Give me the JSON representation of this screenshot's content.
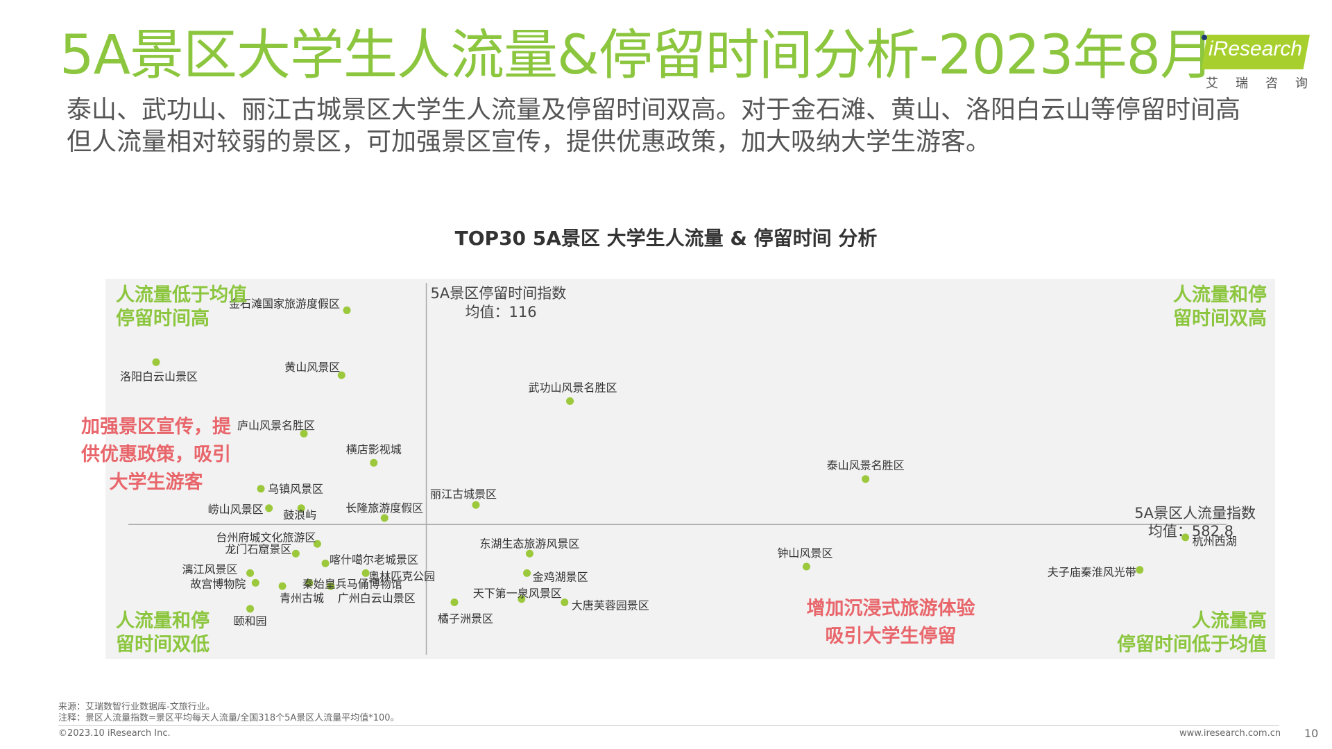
{
  "title": "5A景区大学生人流量&停留时间分析-2023年8月",
  "subtitle_line1": "泰山、武功山、丽江古城景区大学生人流量及停留时间双高。对于金石滩、黄山、洛阳白云山等停留时间高",
  "subtitle_line2": "但人流量相对较弱的景区，可加强景区宣传，提供优惠政策，加大吸纳大学生游客。",
  "logo": {
    "text": "Research",
    "cn": "艾瑞咨询"
  },
  "chart_title": "TOP30 5A景区 大学生人流量 & 停留时间 分析",
  "colors": {
    "accent": "#8cc63f",
    "point": "#9cc83b",
    "quadrant_label": "#8cc63f",
    "callout": "#e8666b",
    "plot_bg": "#f2f2f2"
  },
  "chart_data": {
    "type": "scatter",
    "xlabel": "5A景区人流量指数",
    "ylabel": "5A景区停留时间指数",
    "x_mean_label": "均值：582.8",
    "y_mean_label": "均值：116",
    "x_mean": 582.8,
    "y_mean": 116,
    "xlim": [
      0,
      2100
    ],
    "ylim": [
      75,
      190
    ],
    "points": [
      {
        "name": "金石滩国家旅游度假区",
        "x": 435,
        "y": 182
      },
      {
        "name": "洛阳白云山景区",
        "x": 80,
        "y": 166
      },
      {
        "name": "黄山风景区",
        "x": 425,
        "y": 162
      },
      {
        "name": "武功山风景名胜区",
        "x": 850,
        "y": 154
      },
      {
        "name": "庐山风景名胜区",
        "x": 355,
        "y": 144
      },
      {
        "name": "横店影视城",
        "x": 485,
        "y": 135
      },
      {
        "name": "泰山风景名胜区",
        "x": 1400,
        "y": 130
      },
      {
        "name": "乌镇风景区",
        "x": 275,
        "y": 127
      },
      {
        "name": "崂山风景区",
        "x": 290,
        "y": 121
      },
      {
        "name": "鼓浪屿",
        "x": 350,
        "y": 121
      },
      {
        "name": "长隆旅游度假区",
        "x": 505,
        "y": 118
      },
      {
        "name": "丽江古城景区",
        "x": 675,
        "y": 122
      },
      {
        "name": "台州府城文化旅游区",
        "x": 380,
        "y": 110
      },
      {
        "name": "龙门石窟景区",
        "x": 340,
        "y": 107
      },
      {
        "name": "喀什噶尔老城景区",
        "x": 395,
        "y": 104
      },
      {
        "name": "东湖生态旅游风景区",
        "x": 775,
        "y": 107
      },
      {
        "name": "杭州西湖",
        "x": 1995,
        "y": 112
      },
      {
        "name": "钟山风景区",
        "x": 1290,
        "y": 103
      },
      {
        "name": "漓江风景区",
        "x": 255,
        "y": 101
      },
      {
        "name": "奥林匹克公园",
        "x": 470,
        "y": 101
      },
      {
        "name": "金鸡湖景区",
        "x": 770,
        "y": 101
      },
      {
        "name": "夫子庙秦淮风光带",
        "x": 1910,
        "y": 102
      },
      {
        "name": "故宫博物院",
        "x": 265,
        "y": 98
      },
      {
        "name": "秦始皇兵马俑博物馆",
        "x": 365,
        "y": 98
      },
      {
        "name": "青州古城",
        "x": 315,
        "y": 97
      },
      {
        "name": "广州白云山景区",
        "x": 405,
        "y": 97
      },
      {
        "name": "天下第一泉风景区",
        "x": 760,
        "y": 93
      },
      {
        "name": "大唐芙蓉园景区",
        "x": 840,
        "y": 92
      },
      {
        "name": "橘子洲景区",
        "x": 635,
        "y": 92
      },
      {
        "name": "颐和园",
        "x": 255,
        "y": 90
      }
    ],
    "quadrant_labels": {
      "top_left": [
        "人流量低于均值",
        "停留时间高"
      ],
      "top_right": [
        "人流量和停",
        "留时间双高"
      ],
      "bottom_left": [
        "人流量和停",
        "留时间双低"
      ],
      "bottom_right": [
        "人流量高",
        "停留时间低于均值"
      ]
    },
    "callouts": {
      "left": [
        "加强景区宣传，提",
        "供优惠政策，吸引",
        "大学生游客"
      ],
      "bottom": [
        "增加沉浸式旅游体验",
        "吸引大学生停留"
      ]
    }
  },
  "footer": {
    "source": "来源：艾瑞数智行业数据库-文旅行业。",
    "note": "注释：景区人流量指数=景区平均每天人流量/全国318个5A景区人流量平均值*100。",
    "copyright": "©2023.10  iResearch Inc.",
    "url": "www.iresearch.com.cn",
    "page": "10"
  }
}
